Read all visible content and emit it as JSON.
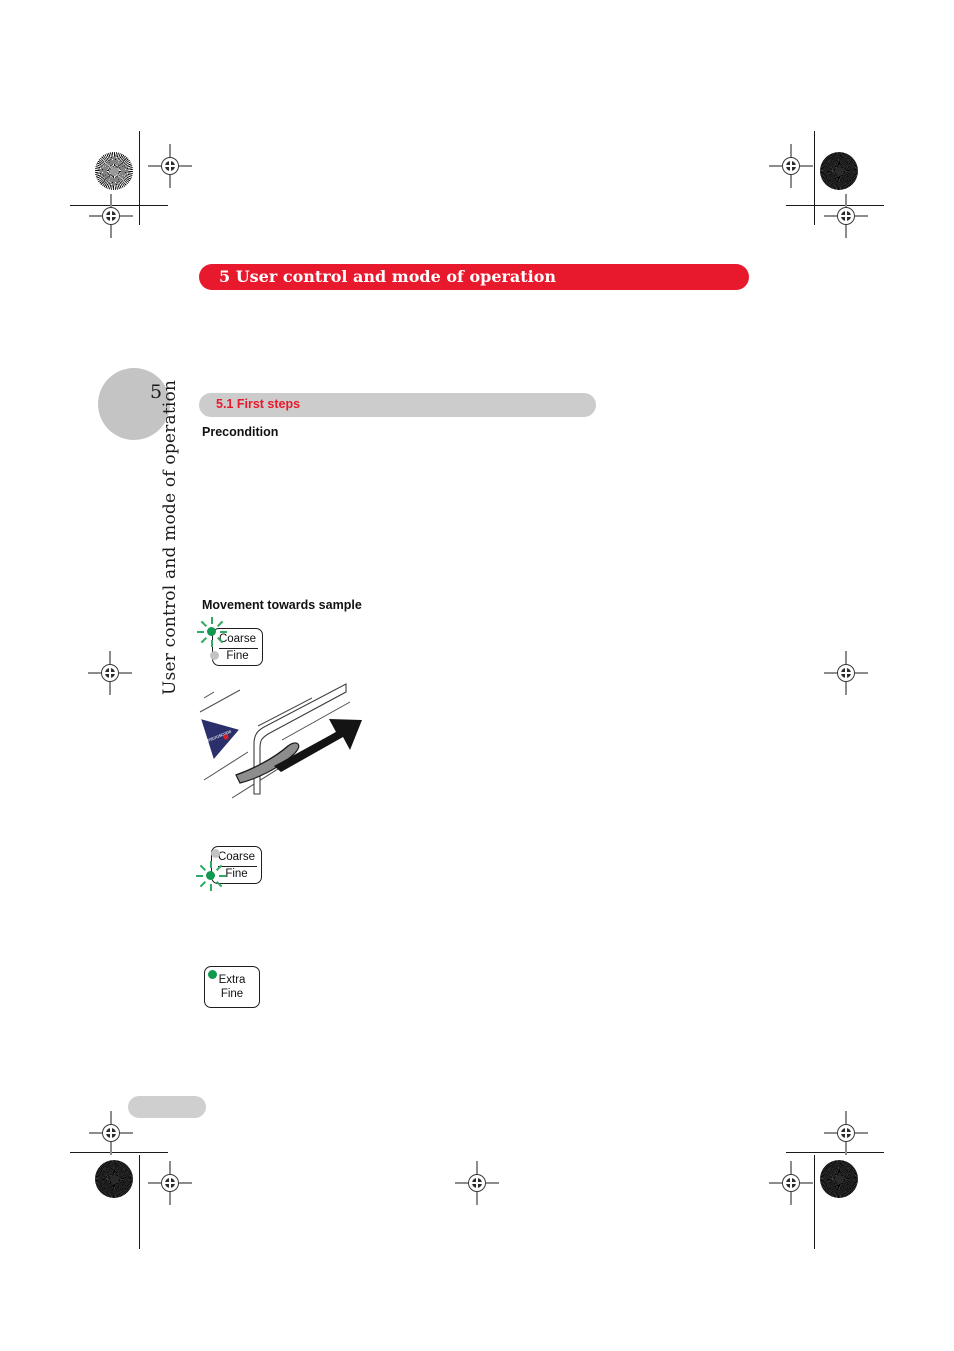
{
  "document": {
    "chapter_number": "5",
    "chapter_banner": "5  User control and mode of operation",
    "sidebar_title": "User control and mode of operation",
    "page_tab_number": "5",
    "accent_red": "#E8192C",
    "heading_bar_gray": "#CCCCCC",
    "led_green": "#12994F",
    "led_gray": "#C3C3C3"
  },
  "section": {
    "bar_label": "5.1  First steps",
    "number": "5.1",
    "title": "First steps"
  },
  "subheadings": {
    "precondition": "Precondition",
    "movement": "Movement towards sample"
  },
  "controls": [
    {
      "name": "coarse-fine-coarse-active",
      "top_label": "Coarse",
      "bottom_label": "Fine",
      "top_led": "on",
      "bottom_led": "off",
      "glow": "top"
    },
    {
      "name": "coarse-fine-fine-active",
      "top_label": "Coarse",
      "bottom_label": "Fine",
      "top_led": "off",
      "bottom_led": "on",
      "glow": "bottom"
    },
    {
      "name": "extra-fine",
      "top_label": "Extra",
      "bottom_label": "Fine",
      "top_led": "on",
      "bottom_led": "none",
      "glow": "none"
    }
  ],
  "illustration": {
    "caption": "",
    "badge_color": "#2b2f6b",
    "badge_dot_color": "#d61f26",
    "arrow_color": "#141414",
    "lever_color": "#8d8d8d"
  },
  "footer": {
    "bar_label": ""
  }
}
